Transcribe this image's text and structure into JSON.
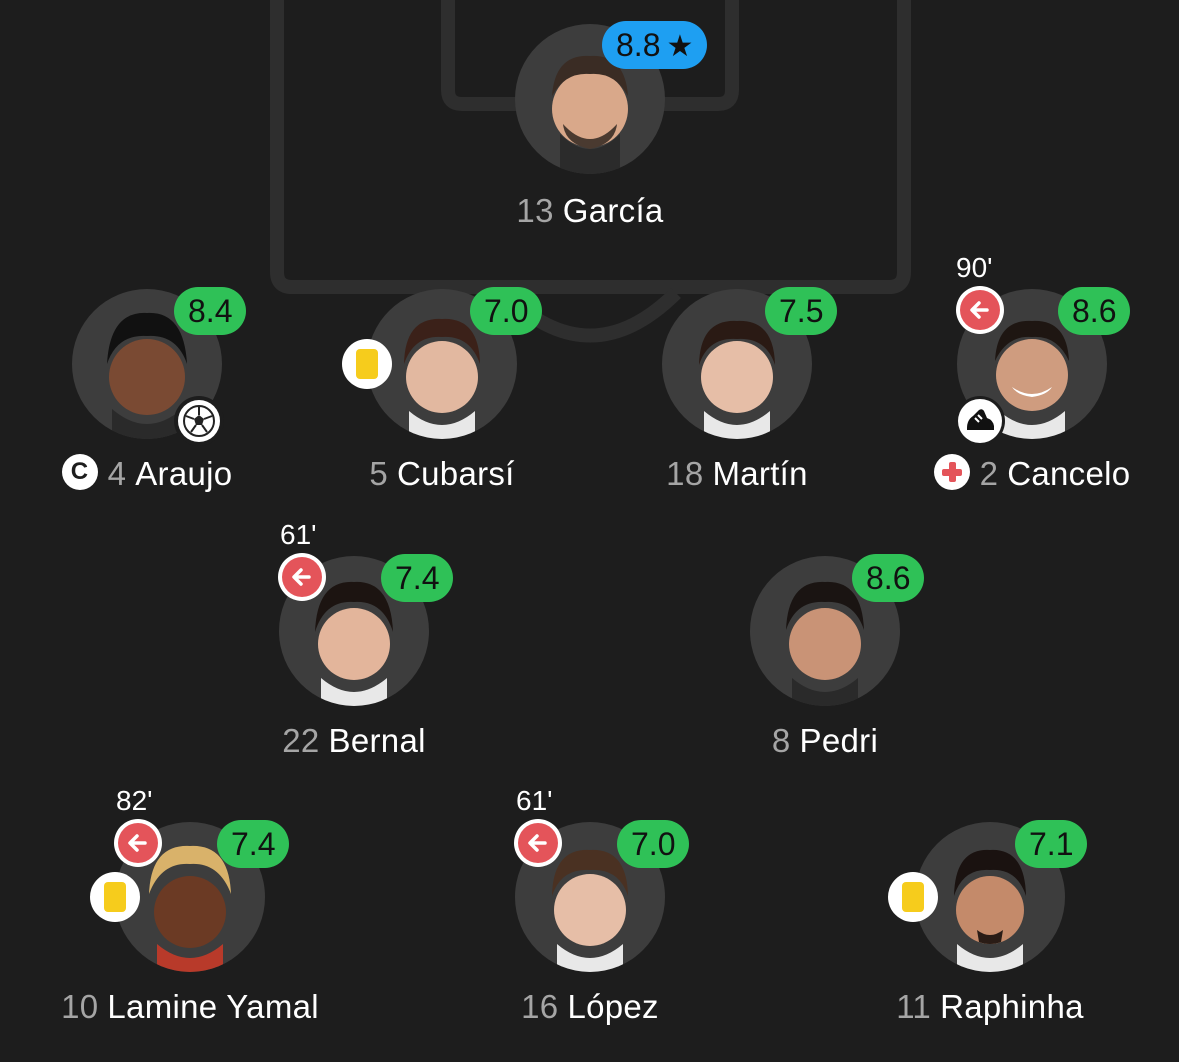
{
  "players": [
    {
      "id": "garcia",
      "number": "13",
      "name": "García",
      "rating": "8.8",
      "star": true
    },
    {
      "id": "araujo",
      "number": "4",
      "name": "Araujo",
      "rating": "8.4",
      "captain_icon": "captain-icon",
      "badge": "goal-icon"
    },
    {
      "id": "cubarsi",
      "number": "5",
      "name": "Cubarsí",
      "rating": "7.0",
      "card": "yellow-card-icon"
    },
    {
      "id": "martin",
      "number": "18",
      "name": "Martín",
      "rating": "7.5"
    },
    {
      "id": "cancelo",
      "number": "2",
      "name": "Cancelo",
      "rating": "8.6",
      "sub_minute": "90'",
      "sub_icon": "substitution-off-icon",
      "injury_icon": "injury-icon",
      "badge": "assist-boot-icon"
    },
    {
      "id": "bernal",
      "number": "22",
      "name": "Bernal",
      "rating": "7.4",
      "sub_minute": "61'",
      "sub_icon": "substitution-off-icon"
    },
    {
      "id": "pedri",
      "number": "8",
      "name": "Pedri",
      "rating": "8.6"
    },
    {
      "id": "yamal",
      "number": "10",
      "name": "Lamine Yamal",
      "rating": "7.4",
      "sub_minute": "82'",
      "sub_icon": "substitution-off-icon",
      "card": "yellow-card-icon"
    },
    {
      "id": "lopez",
      "number": "16",
      "name": "López",
      "rating": "7.0",
      "sub_minute": "61'",
      "sub_icon": "substitution-off-icon"
    },
    {
      "id": "raphinha",
      "number": "11",
      "name": "Raphinha",
      "rating": "7.1",
      "card": "yellow-card-icon"
    }
  ],
  "colors": {
    "background": "#1d1d1d",
    "pitch_lines": "#2e2e2e",
    "rating_green": "#2fc157",
    "rating_best_blue": "#1e9ff2",
    "sub_red": "#e4545a",
    "yellow_card": "#f6cc1c",
    "number_gray": "#a5a5a5"
  }
}
